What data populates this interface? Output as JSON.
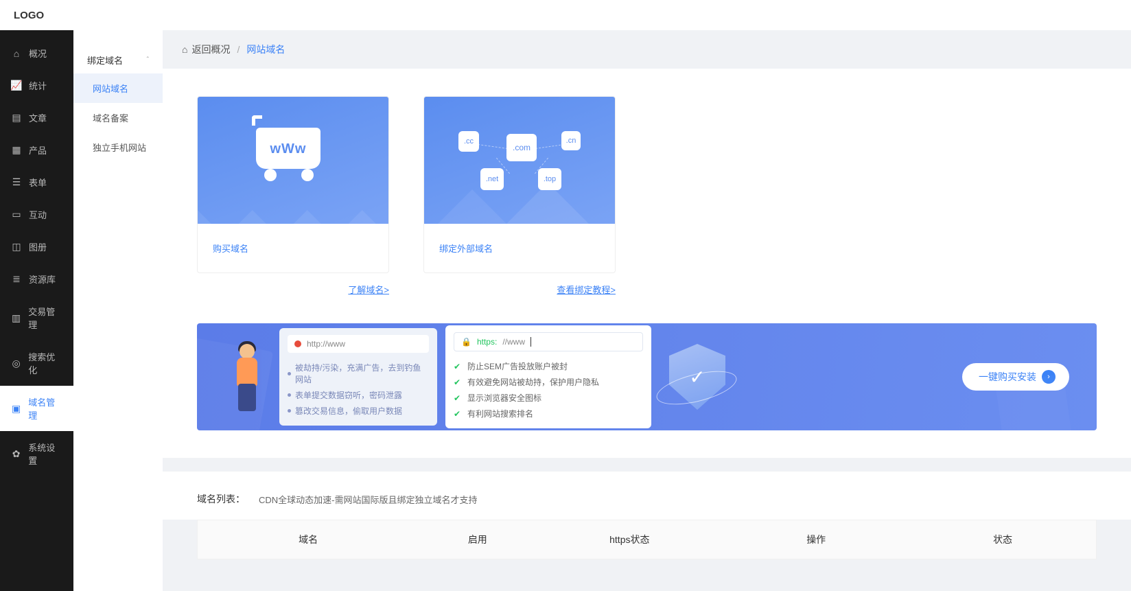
{
  "logo": "LOGO",
  "sidebar": {
    "items": [
      {
        "icon": "home",
        "label": "概况"
      },
      {
        "icon": "stats",
        "label": "统计"
      },
      {
        "icon": "doc",
        "label": "文章"
      },
      {
        "icon": "grid",
        "label": "产品"
      },
      {
        "icon": "form",
        "label": "表单"
      },
      {
        "icon": "chat",
        "label": "互动"
      },
      {
        "icon": "gallery",
        "label": "图册"
      },
      {
        "icon": "db",
        "label": "资源库"
      },
      {
        "icon": "trade",
        "label": "交易管理"
      },
      {
        "icon": "seo",
        "label": "搜索优化"
      },
      {
        "icon": "domain",
        "label": "域名管理"
      },
      {
        "icon": "settings",
        "label": "系统设置"
      }
    ]
  },
  "subnav": {
    "header": "绑定域名",
    "items": [
      {
        "label": "网站域名",
        "active": true
      },
      {
        "label": "域名备案",
        "active": false
      },
      {
        "label": "独立手机网站",
        "active": false
      }
    ]
  },
  "breadcrumb": {
    "back": "返回概况",
    "current": "网站域名"
  },
  "cards": {
    "buy": {
      "title": "购买域名",
      "link": "了解域名>",
      "cart_text": "wWw"
    },
    "bind": {
      "title": "绑定外部域名",
      "link": "查看绑定教程>",
      "tlds": {
        "cc": ".cc",
        "com": ".com",
        "cn": ".cn",
        "net": ".net",
        "top": ".top"
      }
    }
  },
  "banner": {
    "http_placeholder": "http://www",
    "https_prefix": "https:",
    "https_rest": "//www",
    "http_list": [
      "被劫持/污染，充满广告，去到钓鱼网站",
      "表单提交数据窃听，密码泄露",
      "篡改交易信息，偷取用户数据"
    ],
    "https_list": [
      "防止SEM广告投放账户被封",
      "有效避免网站被劫持，保护用户隐私",
      "显示浏览器安全图标",
      "有利网站搜索排名"
    ],
    "cta": "一键购买安装"
  },
  "domain_list": {
    "label": "域名列表：",
    "note": "CDN全球动态加速-需网站国际版且绑定独立域名才支持",
    "columns": [
      "域名",
      "启用",
      "https状态",
      "操作",
      "状态"
    ]
  }
}
